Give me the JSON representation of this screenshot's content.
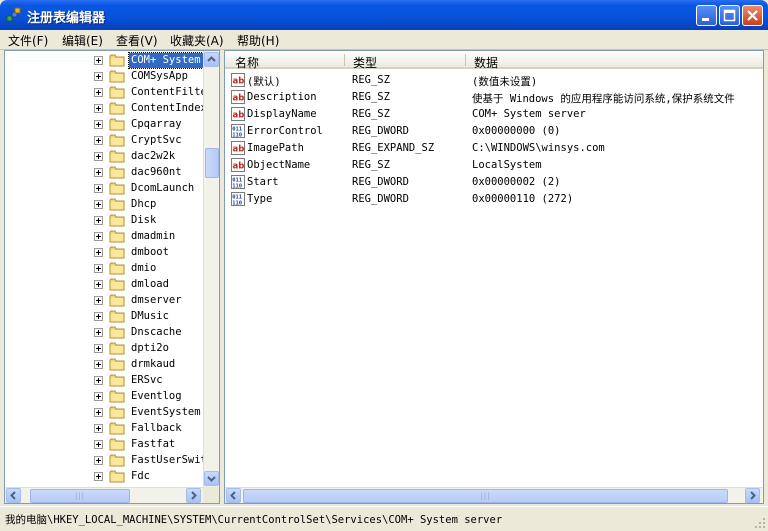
{
  "window": {
    "title": "注册表编辑器"
  },
  "menu": [
    "文件(F)",
    "编辑(E)",
    "查看(V)",
    "收藏夹(A)",
    "帮助(H)"
  ],
  "tree": {
    "selected": "COM+ System",
    "items": [
      "COM+ System",
      "COMSysApp",
      "ContentFilte",
      "ContentIndex",
      "Cpqarray",
      "CryptSvc",
      "dac2w2k",
      "dac960nt",
      "DcomLaunch",
      "Dhcp",
      "Disk",
      "dmadmin",
      "dmboot",
      "dmio",
      "dmload",
      "dmserver",
      "DMusic",
      "Dnscache",
      "dpti2o",
      "drmkaud",
      "ERSvc",
      "Eventlog",
      "EventSystem",
      "Fallback",
      "Fastfat",
      "FastUserSwit",
      "Fdc"
    ]
  },
  "list": {
    "columns": [
      "名称",
      "类型",
      "数据"
    ],
    "rows": [
      {
        "icon": "string-value-icon",
        "name": "(默认)",
        "type": "REG_SZ",
        "data": "(数值未设置)"
      },
      {
        "icon": "string-value-icon",
        "name": "Description",
        "type": "REG_SZ",
        "data": "使基于 Windows 的应用程序能访问系统,保护系统文件"
      },
      {
        "icon": "string-value-icon",
        "name": "DisplayName",
        "type": "REG_SZ",
        "data": "COM+ System server"
      },
      {
        "icon": "binary-value-icon",
        "name": "ErrorControl",
        "type": "REG_DWORD",
        "data": "0x00000000 (0)"
      },
      {
        "icon": "string-value-icon",
        "name": "ImagePath",
        "type": "REG_EXPAND_SZ",
        "data": "C:\\WINDOWS\\winsys.com"
      },
      {
        "icon": "string-value-icon",
        "name": "ObjectName",
        "type": "REG_SZ",
        "data": "LocalSystem"
      },
      {
        "icon": "binary-value-icon",
        "name": "Start",
        "type": "REG_DWORD",
        "data": "0x00000002 (2)"
      },
      {
        "icon": "binary-value-icon",
        "name": "Type",
        "type": "REG_DWORD",
        "data": "0x00000110 (272)"
      }
    ]
  },
  "status": {
    "path": "我的电脑\\HKEY_LOCAL_MACHINE\\SYSTEM\\CurrentControlSet\\Services\\COM+ System server"
  },
  "colors": {
    "titlebar": "#0752d9",
    "selection": "#316ac5",
    "close_button": "#c8401b"
  }
}
